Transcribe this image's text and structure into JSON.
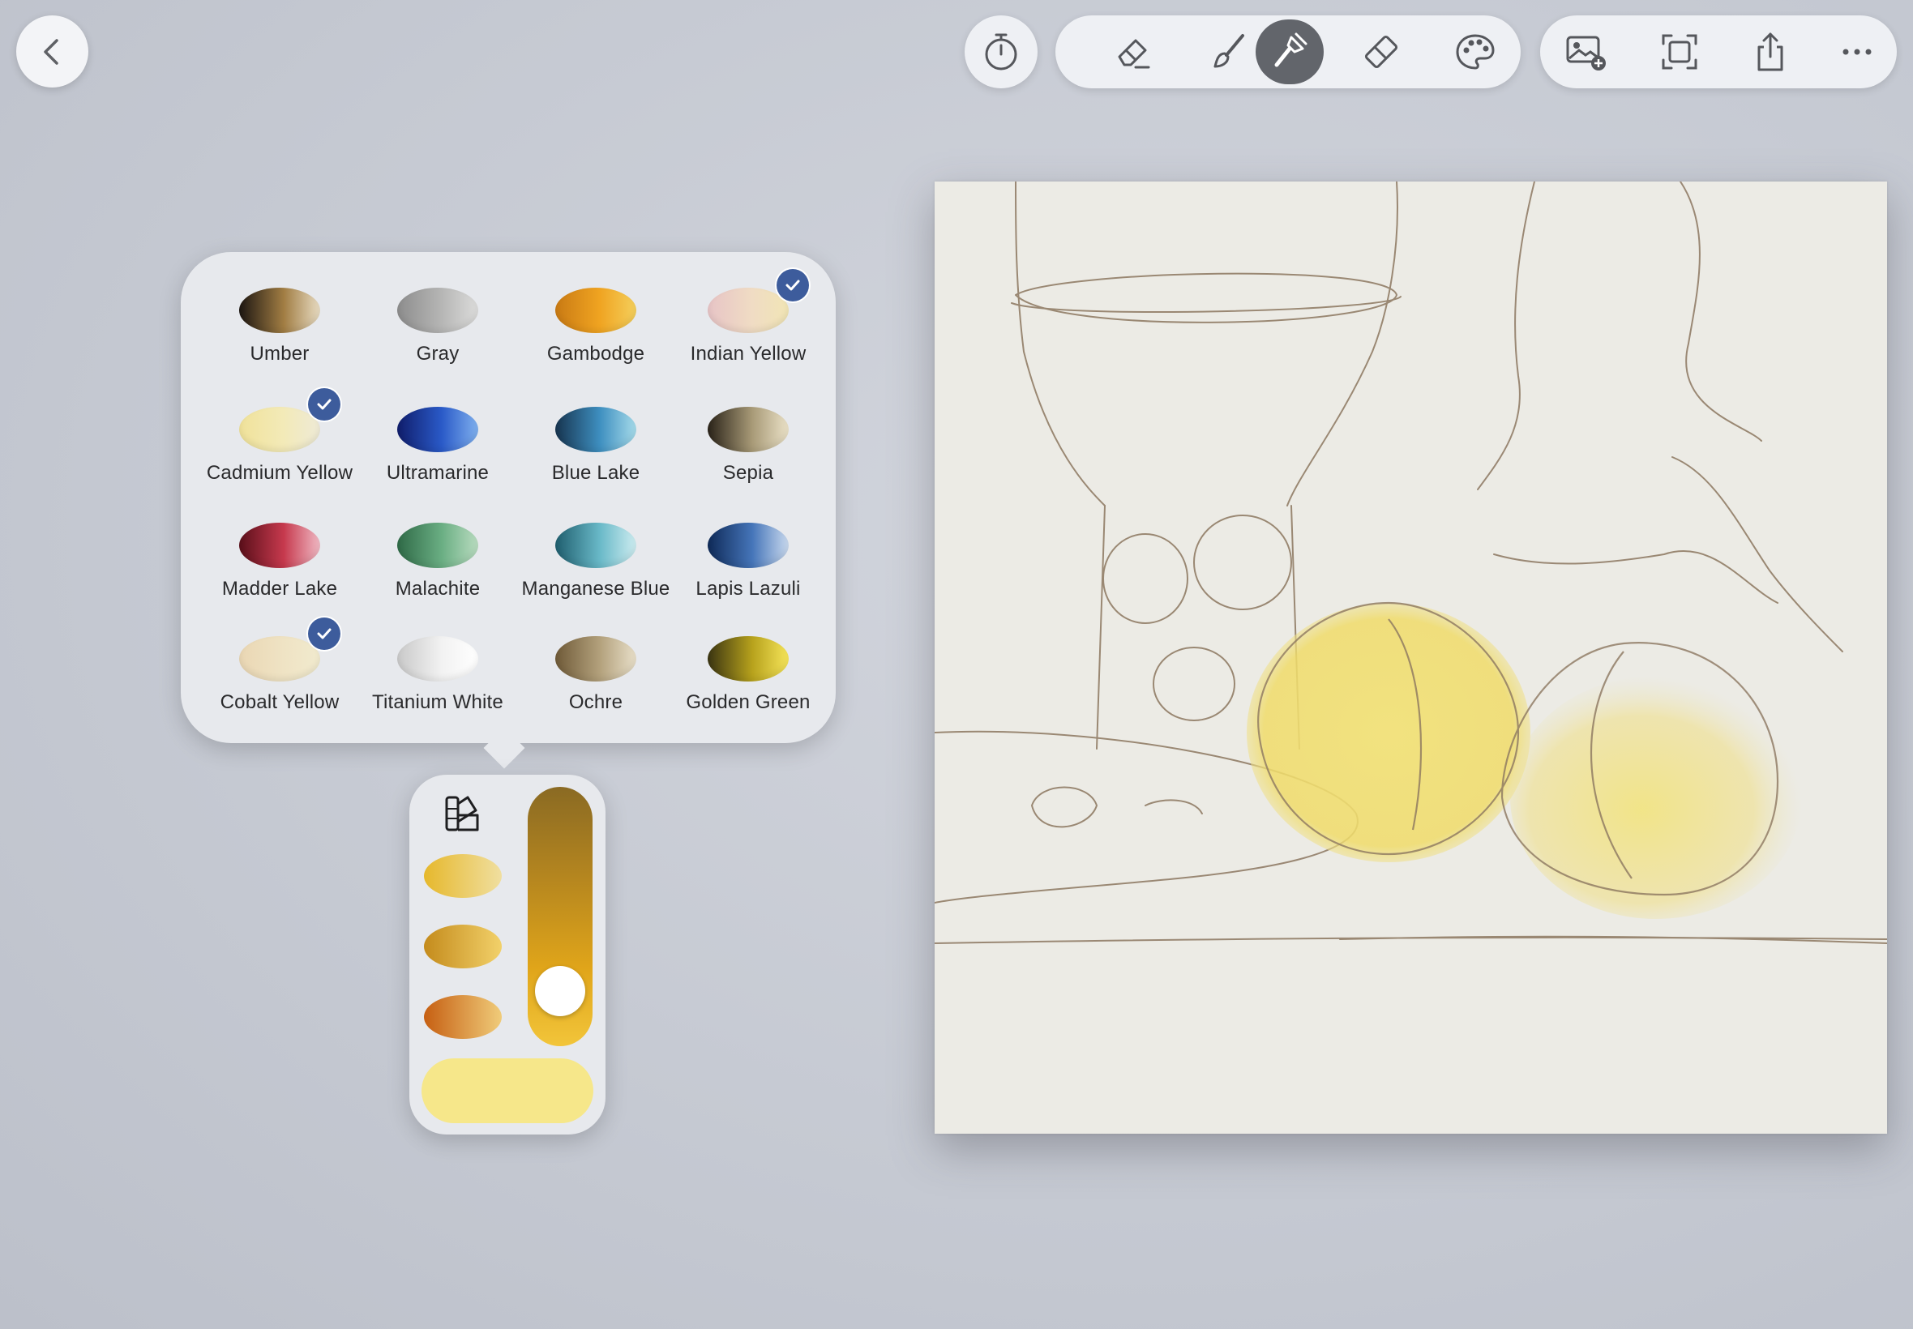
{
  "toolbar": {
    "back": "chevron-left-icon",
    "timer": "timer-icon",
    "tools": [
      "eraser-icon",
      "brush-icon",
      "paint-brush-icon",
      "smudge-eraser-icon",
      "palette-icon"
    ],
    "active_tool": "paint-brush-icon",
    "actions": [
      "add-image-icon",
      "fit-screen-icon",
      "share-icon",
      "more-icon"
    ]
  },
  "palette": {
    "colors": [
      {
        "label": "Umber",
        "checked": false,
        "c1": "#1c1612",
        "c2": "#a17d43",
        "c3": "#e8dcc3"
      },
      {
        "label": "Gray",
        "checked": false,
        "c1": "#8d8d8d",
        "c2": "#b6b6b5",
        "c3": "#dcdcdb"
      },
      {
        "label": "Gambodge",
        "checked": false,
        "c1": "#c97a14",
        "c2": "#f0a421",
        "c3": "#f4cf5c"
      },
      {
        "label": "Indian Yellow",
        "checked": true,
        "c1": "#e7c4c6",
        "c2": "#f0dcc4",
        "c3": "#f1e5b5"
      },
      {
        "label": "Cadmium Yellow",
        "checked": true,
        "c1": "#f0e29a",
        "c2": "#f3eab8",
        "c3": "#eeead6"
      },
      {
        "label": "Ultramarine",
        "checked": false,
        "c1": "#101d6b",
        "c2": "#2a5ac8",
        "c3": "#7fb0ee"
      },
      {
        "label": "Blue Lake",
        "checked": false,
        "c1": "#17344f",
        "c2": "#3e8fc0",
        "c3": "#a6dbea"
      },
      {
        "label": "Sepia",
        "checked": false,
        "c1": "#2a2319",
        "c2": "#a89a77",
        "c3": "#ebe2c8"
      },
      {
        "label": "Madder Lake",
        "checked": false,
        "c1": "#5a0f1a",
        "c2": "#c6394d",
        "c3": "#f0b9c4"
      },
      {
        "label": "Malachite",
        "checked": false,
        "c1": "#2f6a47",
        "c2": "#6aae83",
        "c3": "#b9dcc0"
      },
      {
        "label": "Manganese Blue",
        "checked": false,
        "c1": "#1f5e6e",
        "c2": "#69b9c8",
        "c3": "#cdecf0"
      },
      {
        "label": "Lapis Lazuli",
        "checked": false,
        "c1": "#0f2a58",
        "c2": "#4575b9",
        "c3": "#c9d9ee"
      },
      {
        "label": "Cobalt Yellow",
        "checked": true,
        "c1": "#ead7b4",
        "c2": "#efe3c4",
        "c3": "#f1eace"
      },
      {
        "label": "Titanium White",
        "checked": false,
        "c1": "#c9c9c9",
        "c2": "#f2f2f2",
        "c3": "#ffffff"
      },
      {
        "label": "Ochre",
        "checked": false,
        "c1": "#6f5a38",
        "c2": "#b3a17c",
        "c3": "#e8dfc9"
      },
      {
        "label": "Golden Green",
        "checked": false,
        "c1": "#3a3412",
        "c2": "#b7a21c",
        "c3": "#f6e55a"
      }
    ]
  },
  "mixer": {
    "icon": "color-swatches-icon",
    "mixes": [
      {
        "c1": "#e6b82c",
        "c2": "#f0dfa0"
      },
      {
        "c1": "#c48b1c",
        "c2": "#f2d16a"
      },
      {
        "c1": "#c65f12",
        "c2": "#f0cc7a"
      }
    ],
    "level": 0.12,
    "current_color": "#f6e78a"
  }
}
